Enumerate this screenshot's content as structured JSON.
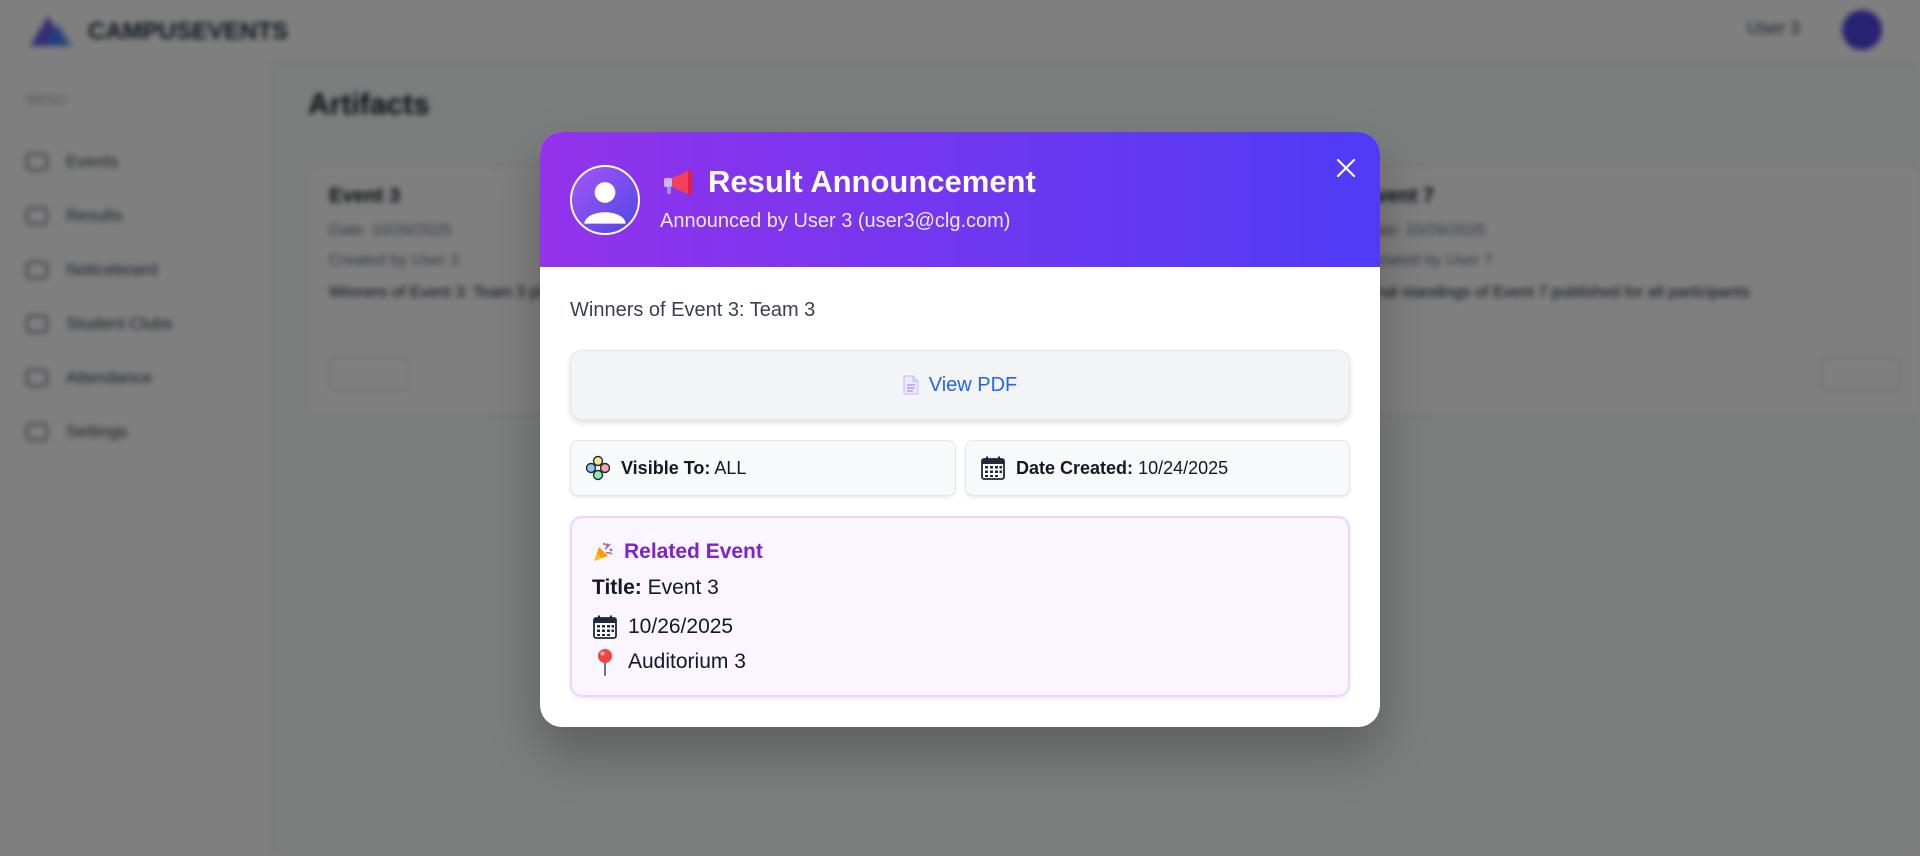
{
  "background": {
    "brand": "CAMPUSEVENTS",
    "topbar_user": "User 3",
    "sidebar_section": "MENU",
    "sidebar_items": [
      "Events",
      "Results",
      "Noticeboard",
      "Student Clubs",
      "Attendance",
      "Settings"
    ],
    "page_title": "Artifacts",
    "cards": [
      {
        "title": "Event 3",
        "sub": "Date: 10/26/2025",
        "meta": "Created by User 3",
        "desc": "Winners of Event 3: Team 3 placed at the Auditorium 3 venue"
      },
      {
        "title": "Event 7",
        "sub": "Date: 10/28/2025",
        "meta": "Created by User 7",
        "desc": "Final standings of Event 7 published for all participants"
      }
    ]
  },
  "modal": {
    "icon_title": "megaphone-icon",
    "title": "Result Announcement",
    "subtitle": "Announced by User 3 (user3@clg.com)",
    "description": "Winners of Event 3: Team 3",
    "pdf_label": "View PDF",
    "visible_to_label": "Visible To:",
    "visible_to_value": "ALL",
    "date_created_label": "Date Created:",
    "date_created_value": "10/24/2025",
    "related_event": {
      "heading": "Related Event",
      "title_label": "Title:",
      "title_value": "Event 3",
      "date": "10/26/2025",
      "venue": "Auditorium 3"
    }
  },
  "colors": {
    "header_gradient_start": "#9333ea",
    "header_gradient_end": "#4f3bf6",
    "link_blue": "#2563eb",
    "event_purple": "#7e22ce",
    "event_bg": "#faf5ff"
  }
}
